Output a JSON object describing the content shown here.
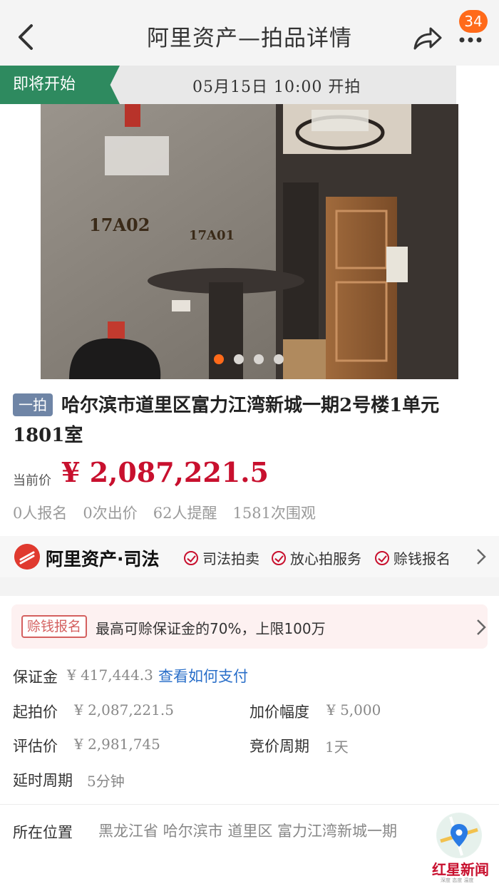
{
  "header": {
    "title": "阿里资产—拍品详情",
    "badge_count": "34"
  },
  "status": {
    "tag": "即将开始",
    "time": "05月15日 10:00 开拍"
  },
  "gallery": {
    "slides": 4,
    "active_index": 0,
    "plaque_a": "17A02",
    "plaque_b": "17A01"
  },
  "lot": {
    "round_tag": "一拍",
    "title": "哈尔滨市道里区富力江湾新城一期2号楼1单元1801室",
    "price_label": "当前价",
    "price": "¥ 2,087,221.5",
    "stats": [
      "0人报名",
      "0次出价",
      "62人提醒",
      "1581次围观"
    ]
  },
  "platform": {
    "name": "阿里资产·司法",
    "features": [
      "司法拍卖",
      "放心拍服务",
      "赊钱报名"
    ]
  },
  "compensation": {
    "tag": "赊钱报名",
    "text": "最高可赊保证金的70%，上限100万"
  },
  "details": {
    "deposit_label": "保证金",
    "deposit_value": "¥ 417,444.3",
    "deposit_link": "查看如何支付",
    "start_label": "起拍价",
    "start_value": "¥ 2,087,221.5",
    "increment_label": "加价幅度",
    "increment_value": "¥ 5,000",
    "appraisal_label": "评估价",
    "appraisal_value": "¥ 2,981,745",
    "cycle_label": "竞价周期",
    "cycle_value": "1天",
    "delay_label": "延时周期",
    "delay_value": "5分钟",
    "location_label": "所在位置",
    "location_value": "黑龙江省 哈尔滨市 道里区 富力江湾新城一期"
  },
  "watermark": {
    "brand": "红星新闻",
    "sub": "深度 态度 温度"
  },
  "colors": {
    "accent_red": "#c8102e",
    "status_green": "#2e8a5f",
    "badge_orange": "#ff6a1a",
    "link_blue": "#2a6fc9"
  }
}
